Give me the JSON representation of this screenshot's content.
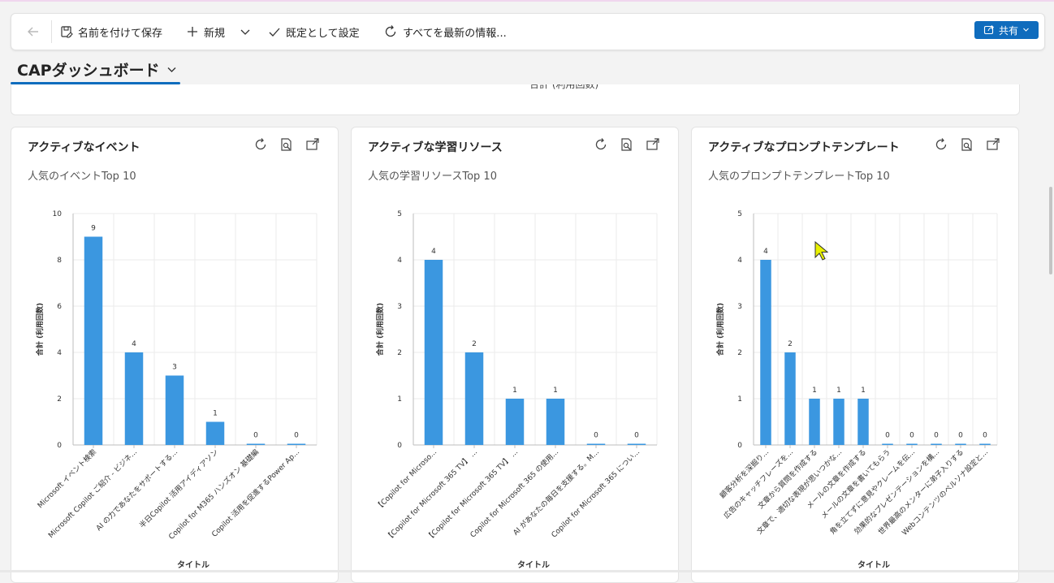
{
  "toolbar": {
    "save_as": "名前を付けて保存",
    "new": "新規",
    "set_default": "既定として設定",
    "refresh_all": "すべてを最新の情報...",
    "share": "共有"
  },
  "dashboard": {
    "title": "CAPダッシュボード",
    "top_card_clip": "合計 (利用回数)"
  },
  "cards": [
    {
      "title": "アクティブなイベント",
      "subtitle": "人気のイベントTop 10",
      "chart_data": {
        "type": "bar",
        "ylabel": "合計 (利用回数)",
        "xlabel": "タイトル",
        "ylim": [
          0,
          10
        ],
        "yticks": [
          0,
          2,
          4,
          6,
          8,
          10
        ],
        "categories": [
          "Microsoft イベント検索",
          "Microsoft Copilot ご紹介 - ビジネ...",
          "AI の力であなたをサポートする...",
          "半日Copilot 活用アイディアソン",
          "Copilot for M365 ハンズオン 基礎編",
          "Copilot 活用を促進するPower Ap..."
        ],
        "values": [
          9,
          4,
          3,
          1,
          0,
          0
        ]
      }
    },
    {
      "title": "アクティブな学習リソース",
      "subtitle": "人気の学習リソースTop 10",
      "chart_data": {
        "type": "bar",
        "ylabel": "合計 (利用回数)",
        "xlabel": "タイトル",
        "ylim": [
          0,
          5
        ],
        "yticks": [
          0,
          1,
          2,
          3,
          4,
          5
        ],
        "categories": [
          "【Copilot for Microso...",
          "【Copilot for Microsoft 365 TV】 ...",
          "【Copilot for Microsoft 365 TV】 ...",
          "Copilot for Microsoft 365 の使用...",
          "AI があなたの毎日を支援する。M...",
          "Copilot for Microsoft 365 につい..."
        ],
        "values": [
          4,
          2,
          1,
          1,
          0,
          0
        ]
      }
    },
    {
      "title": "アクティブなプロンプトテンプレート",
      "subtitle": "人気のプロンプトテンプレートTop 10",
      "chart_data": {
        "type": "bar",
        "ylabel": "合計 (利用回数)",
        "xlabel": "タイトル",
        "ylim": [
          0,
          5
        ],
        "yticks": [
          0,
          1,
          2,
          3,
          4,
          5
        ],
        "categories": [
          "顧客分析を深掘り...",
          "広告のキャッチフレーズを...",
          "文章から質問を作成する",
          "文章で、適切な表現が思いつかな...",
          "メールの文章を作成する",
          "メールの文章を書いてもらう",
          "角を立てずに意見やクレームを伝...",
          "効果的なプレゼンテーションを構...",
          "世界最高のメンターに弟子入りする",
          "Webコンテンツのペルソナ設定と..."
        ],
        "values": [
          4,
          2,
          1,
          1,
          1,
          0,
          0,
          0,
          0,
          0
        ]
      }
    }
  ],
  "colors": {
    "bar": "#3b97e0",
    "accent": "#0f6cbd"
  }
}
